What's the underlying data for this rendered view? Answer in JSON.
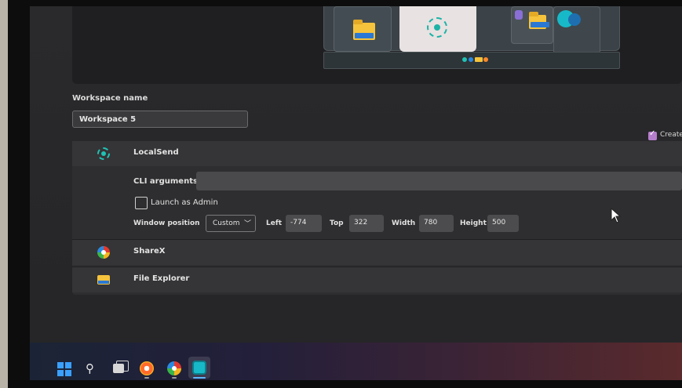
{
  "workspace": {
    "name_label": "Workspace name",
    "name_value": "Workspace 5",
    "create_label": "Create"
  },
  "apps": [
    {
      "name": "LocalSend",
      "icon": "localsend-icon"
    },
    {
      "name": "ShareX",
      "icon": "sharex-icon"
    },
    {
      "name": "File Explorer",
      "icon": "folder-icon"
    }
  ],
  "localsend_options": {
    "cli_label": "CLI arguments",
    "cli_value": "",
    "admin_label": "Launch as Admin",
    "admin_checked": false,
    "window_position_label": "Window position",
    "window_position_value": "Custom",
    "left_label": "Left",
    "left_value": "-774",
    "top_label": "Top",
    "top_value": "322",
    "width_label": "Width",
    "width_value": "780",
    "height_label": "Height",
    "height_value": "500"
  },
  "taskbar": {
    "icons": [
      "windows-start-icon",
      "search-icon",
      "task-view-icon",
      "app-icon",
      "sharex-icon",
      "workspaces-icon"
    ]
  },
  "colors": {
    "accent": "#b57ecb",
    "localsend": "#1fc3b4",
    "folder": "#f5c33c",
    "windows_blue": "#3aa0ff"
  }
}
